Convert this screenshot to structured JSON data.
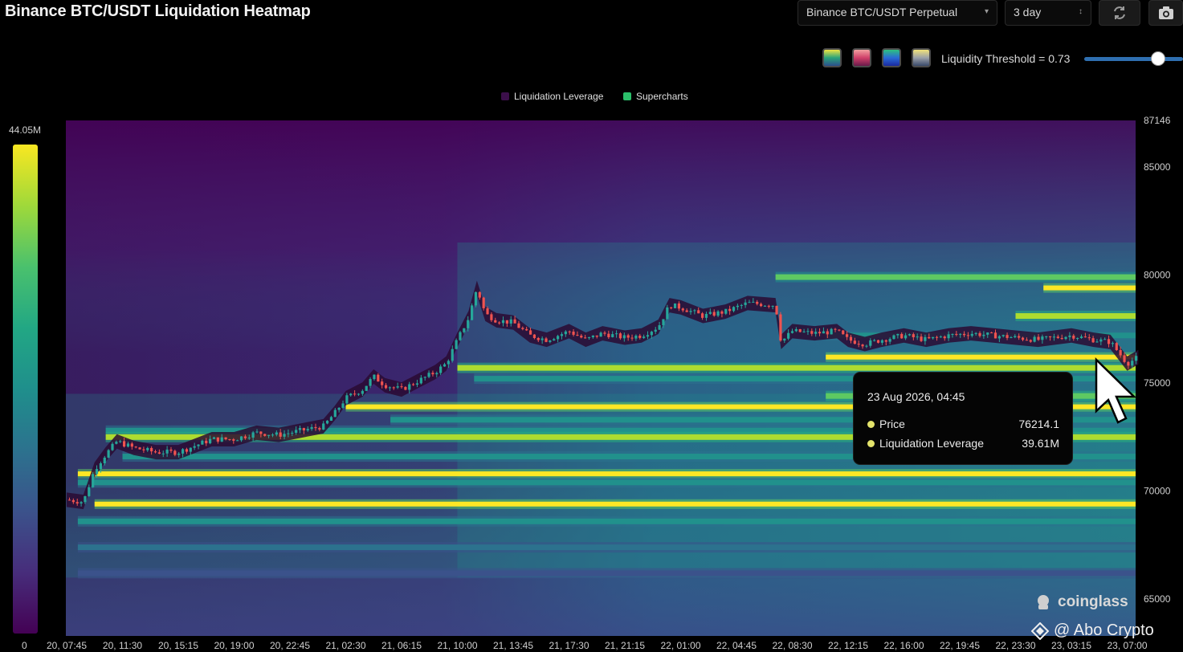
{
  "title": "Binance BTC/USDT Liquidation Heatmap",
  "controls": {
    "pair_select": "Binance BTC/USDT Perpetual",
    "range_select": "3 day",
    "refresh_icon": "refresh-icon",
    "camera_icon": "camera-icon",
    "threshold_label": "Liquidity Threshold = 0.73",
    "threshold_value": 0.73,
    "palettes": [
      {
        "name": "viridis",
        "colors": [
          "#f0e442",
          "#2aa37a",
          "#2c4f8c"
        ]
      },
      {
        "name": "magma",
        "colors": [
          "#f2a0a0",
          "#d0406a",
          "#6a1a4a"
        ]
      },
      {
        "name": "blue-green",
        "colors": [
          "#2ec27e",
          "#2a6ad6",
          "#1a2aa0"
        ]
      },
      {
        "name": "yellow-grey",
        "colors": [
          "#f1e27a",
          "#9aa0a8",
          "#3a4a6a"
        ]
      }
    ]
  },
  "legend": [
    {
      "label": "Liquidation Leverage",
      "color": "#3b0f4a"
    },
    {
      "label": "Supercharts",
      "color": "#2bbf6a"
    }
  ],
  "colorbar": {
    "max_label": "44.05M",
    "min_label": "0"
  },
  "tooltip": {
    "date": "23 Aug 2026, 04:45",
    "price_label": "Price",
    "price_value": "76214.1",
    "lev_label": "Liquidation Leverage",
    "lev_value": "39.61M"
  },
  "watermark": "coinglass",
  "channel": "@ Abo Crypto",
  "chart_data": {
    "type": "heatmap",
    "title": "Binance BTC/USDT Liquidation Heatmap",
    "x_ticks": [
      "20, 07:45",
      "20, 11:30",
      "20, 15:15",
      "20, 19:00",
      "20, 22:45",
      "21, 02:30",
      "21, 06:15",
      "21, 10:00",
      "21, 13:45",
      "21, 17:30",
      "21, 21:15",
      "22, 01:00",
      "22, 04:45",
      "22, 08:30",
      "22, 12:15",
      "22, 16:00",
      "22, 19:45",
      "22, 23:30",
      "23, 03:15",
      "23, 07:00"
    ],
    "y_ticks": [
      87146,
      85000,
      80000,
      75000,
      70000,
      65000
    ],
    "ylim": [
      63300,
      87146
    ],
    "colorbar_range": [
      "0",
      "44.05M"
    ],
    "bands": [
      {
        "price": 79900,
        "start_tick": 12.7,
        "intensity": 0.7
      },
      {
        "price": 79400,
        "start_tick": 17.5,
        "intensity": 0.95
      },
      {
        "price": 78100,
        "start_tick": 17.0,
        "intensity": 0.85
      },
      {
        "price": 77200,
        "start_tick": 13.6,
        "intensity": 0.5
      },
      {
        "price": 76200,
        "start_tick": 13.6,
        "intensity": 1.0
      },
      {
        "price": 75700,
        "start_tick": 7.0,
        "intensity": 0.9
      },
      {
        "price": 75200,
        "start_tick": 7.3,
        "intensity": 0.55
      },
      {
        "price": 74400,
        "start_tick": 13.6,
        "intensity": 0.8
      },
      {
        "price": 73900,
        "start_tick": 5.0,
        "intensity": 0.95
      },
      {
        "price": 73300,
        "start_tick": 5.8,
        "intensity": 0.55
      },
      {
        "price": 72800,
        "start_tick": 0.7,
        "intensity": 0.55
      },
      {
        "price": 72500,
        "start_tick": 0.7,
        "intensity": 0.85
      },
      {
        "price": 71600,
        "start_tick": 1.0,
        "intensity": 0.45
      },
      {
        "price": 70800,
        "start_tick": 0.2,
        "intensity": 1.0
      },
      {
        "price": 70400,
        "start_tick": 0.2,
        "intensity": 0.55
      },
      {
        "price": 69400,
        "start_tick": 0.5,
        "intensity": 1.0
      },
      {
        "price": 68600,
        "start_tick": 0.2,
        "intensity": 0.5
      },
      {
        "price": 67400,
        "start_tick": 0.2,
        "intensity": 0.35
      },
      {
        "price": 66200,
        "start_tick": 0.2,
        "intensity": 0.25
      }
    ],
    "price_path": [
      [
        0.0,
        69600
      ],
      [
        0.3,
        69500
      ],
      [
        0.5,
        71000
      ],
      [
        0.7,
        71700
      ],
      [
        0.9,
        72300
      ],
      [
        1.2,
        72000
      ],
      [
        1.6,
        71800
      ],
      [
        2.0,
        71800
      ],
      [
        2.3,
        72100
      ],
      [
        2.6,
        72400
      ],
      [
        3.0,
        72400
      ],
      [
        3.4,
        72700
      ],
      [
        3.8,
        72600
      ],
      [
        4.2,
        72800
      ],
      [
        4.6,
        73000
      ],
      [
        4.8,
        73600
      ],
      [
        5.0,
        74300
      ],
      [
        5.3,
        74700
      ],
      [
        5.5,
        75300
      ],
      [
        5.7,
        74900
      ],
      [
        6.0,
        74700
      ],
      [
        6.3,
        75100
      ],
      [
        6.6,
        75500
      ],
      [
        6.8,
        75900
      ],
      [
        7.0,
        77000
      ],
      [
        7.2,
        78000
      ],
      [
        7.35,
        79400
      ],
      [
        7.5,
        78200
      ],
      [
        7.7,
        77900
      ],
      [
        8.0,
        77800
      ],
      [
        8.3,
        77200
      ],
      [
        8.6,
        77000
      ],
      [
        9.0,
        77400
      ],
      [
        9.3,
        77000
      ],
      [
        9.6,
        77300
      ],
      [
        10.0,
        77100
      ],
      [
        10.3,
        77200
      ],
      [
        10.6,
        77600
      ],
      [
        10.8,
        78600
      ],
      [
        11.0,
        78500
      ],
      [
        11.4,
        78100
      ],
      [
        11.8,
        78300
      ],
      [
        12.2,
        78700
      ],
      [
        12.7,
        78600
      ],
      [
        12.8,
        76900
      ],
      [
        13.0,
        77400
      ],
      [
        13.4,
        77300
      ],
      [
        13.8,
        77400
      ],
      [
        14.0,
        77000
      ],
      [
        14.3,
        76800
      ],
      [
        14.6,
        77000
      ],
      [
        15.0,
        77200
      ],
      [
        15.4,
        77000
      ],
      [
        15.8,
        77200
      ],
      [
        16.2,
        77300
      ],
      [
        16.6,
        77200
      ],
      [
        17.0,
        77100
      ],
      [
        17.4,
        77000
      ],
      [
        18.0,
        77200
      ],
      [
        18.4,
        77000
      ],
      [
        18.7,
        76900
      ],
      [
        19.0,
        75900
      ],
      [
        19.2,
        76200
      ]
    ]
  }
}
